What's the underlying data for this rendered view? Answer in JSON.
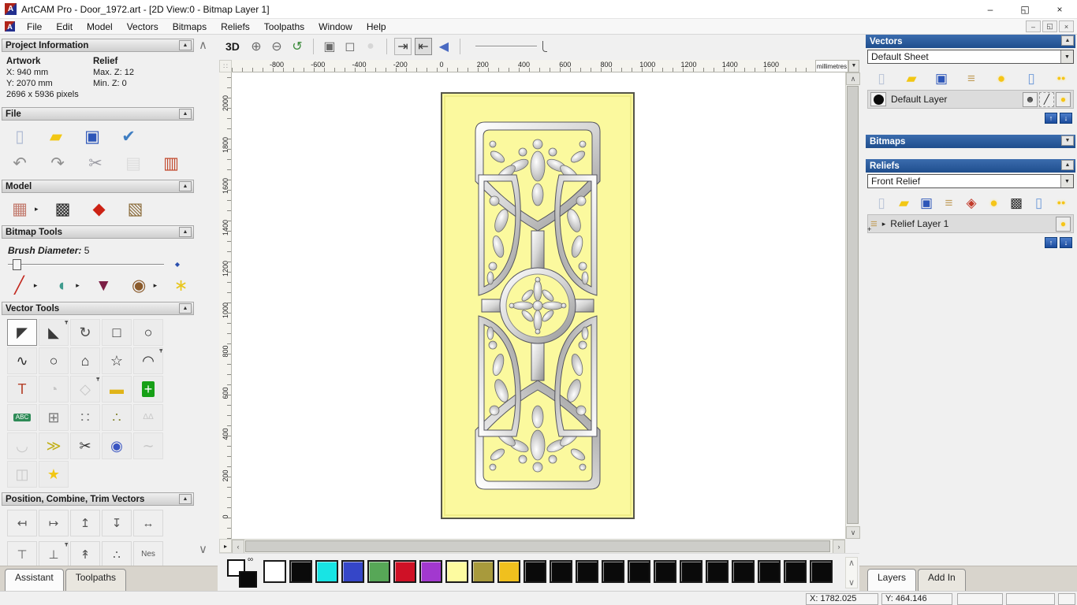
{
  "window": {
    "title": "ArtCAM Pro - Door_1972.art - [2D View:0 - Bitmap Layer 1]",
    "app_initial": "A",
    "minimize": "–",
    "restore": "◱",
    "close": "×"
  },
  "menu": {
    "items": [
      "File",
      "Edit",
      "Model",
      "Vectors",
      "Bitmaps",
      "Reliefs",
      "Toolpaths",
      "Window",
      "Help"
    ],
    "mdi_minimize": "–",
    "mdi_restore": "◱",
    "mdi_close": "×"
  },
  "ui": {
    "collapse_up": "▲",
    "collapse_down": "▼",
    "scroll_up": "∧",
    "scroll_down": "∨",
    "expander": "▸",
    "corner_grid": "∷",
    "pan_glyph": "▸"
  },
  "assistant": {
    "project": {
      "title": "Project Information",
      "artwork_label": "Artwork",
      "relief_label": "Relief",
      "artwork_x": "X: 940 mm",
      "artwork_y": "Y: 2070 mm",
      "relief_max": "Max. Z: 12",
      "relief_min": "Min. Z: 0",
      "pixels": "2696 x 5936 pixels"
    },
    "file": {
      "title": "File",
      "row1": [
        {
          "n": "new-model-icon",
          "g": "▯",
          "c": "#aebad2"
        },
        {
          "n": "open-model-icon",
          "g": "▰",
          "c": "#f2c714"
        },
        {
          "n": "save-model-icon",
          "g": "▣",
          "c": "#2d56b8"
        },
        {
          "n": "model-properties-icon",
          "g": "✔",
          "c": "#3f7ec2"
        }
      ],
      "row2": [
        {
          "n": "undo-icon",
          "g": "↶",
          "c": "#8f8f8f"
        },
        {
          "n": "redo-icon",
          "g": "↷",
          "c": "#8f8f8f"
        },
        {
          "n": "cut-icon",
          "g": "✂",
          "c": "#9a9aa2"
        },
        {
          "n": "copy-icon",
          "g": "▤",
          "c": "#c6c6c6",
          "gray": true
        },
        {
          "n": "paste-icon",
          "g": "▥",
          "c": "#c24a2e"
        }
      ]
    },
    "model": {
      "title": "Model",
      "row": [
        {
          "n": "greyscale-preview-icon",
          "g": "▦",
          "c": "#c27b6e",
          "sub": true
        },
        {
          "n": "view-greyscale-icon",
          "g": "▩",
          "c": "#2b2b2b"
        },
        {
          "n": "lighting-icon",
          "g": "◆",
          "c": "#cc2214"
        },
        {
          "n": "load-image-icon",
          "g": "▧",
          "c": "#8a6b3a"
        }
      ]
    },
    "bitmap_tools": {
      "title": "Bitmap Tools",
      "brush_label": "Brush Diameter:",
      "brush_value": "5",
      "row": [
        {
          "n": "paint-brush-icon",
          "g": "╱",
          "c": "#c2271d",
          "sub": true
        },
        {
          "n": "flood-fill-icon",
          "g": "◖",
          "c": "#3f9b8e",
          "sub": true
        },
        {
          "n": "colour-picker-icon",
          "g": "▼",
          "c": "#7c1f45"
        },
        {
          "n": "palette-icon",
          "g": "◉",
          "c": "#8a5a2b",
          "sub": true
        },
        {
          "n": "texture-flood-icon",
          "g": "∗",
          "c": "#e8c61c"
        }
      ]
    },
    "vector_tools": {
      "title": "Vector Tools",
      "rows": [
        {
          "n": "select-vectors-icon",
          "g": "◤",
          "c": "#3a3a3a",
          "act": true
        },
        {
          "n": "node-editing-icon",
          "g": "◣",
          "c": "#3a3a3a",
          "pin": true
        },
        {
          "n": "transform-vectors-icon",
          "g": "↻",
          "c": "#4a4a4a"
        },
        {
          "n": "create-rectangle-icon",
          "g": "□",
          "c": "#2f2f2f"
        },
        {
          "n": "create-circle-icon",
          "g": "○",
          "c": "#2f2f2f"
        },
        {
          "n": "create-polyline-icon",
          "g": "∿",
          "c": "#2f2f2f"
        },
        {
          "n": "create-ellipse-icon",
          "g": "○",
          "c": "#2f2f2f"
        },
        {
          "n": "create-polygon-icon",
          "g": "⌂",
          "c": "#2f2f2f"
        },
        {
          "n": "create-star-icon",
          "g": "☆",
          "c": "#2f2f2f"
        },
        {
          "n": "create-arc-icon",
          "g": "◠",
          "c": "#2f2f2f",
          "pin": true
        },
        {
          "n": "create-text-icon",
          "g": "T",
          "c": "#b5412a"
        },
        {
          "n": "wrap-text-icon",
          "g": "◔",
          "c": "#9a9a9a",
          "gray": true
        },
        {
          "n": "offset-vector-icon",
          "g": "◇",
          "c": "#9a9a9a",
          "gray": true,
          "pin": true
        },
        {
          "n": "measure-icon",
          "g": "▬",
          "c": "#e0b418"
        },
        {
          "n": "create-boundary-icon",
          "g": "+",
          "c": "#ffffff",
          "bg": "#17a017"
        },
        {
          "n": "text-block-icon",
          "g": "ABC",
          "c": "#ffffff",
          "bg": "#2e8b57",
          "fs": 8
        },
        {
          "n": "distort-vectors-icon",
          "g": "⊞",
          "c": "#7a7a7a"
        },
        {
          "n": "block-copy-icon",
          "g": "∷",
          "c": "#7a7a7a"
        },
        {
          "n": "paste-along-curve-icon",
          "g": "∴",
          "c": "#8a8a3a"
        },
        {
          "n": "vector-texture-icon",
          "g": "ΔΔ",
          "c": "#9a9a9a",
          "gray": true,
          "fs": 10
        },
        {
          "n": "fillet-icon",
          "g": "◡",
          "c": "#9a9a9a",
          "gray": true
        },
        {
          "n": "join-vectors-icon",
          "g": "≫",
          "c": "#c2b018"
        },
        {
          "n": "trim-vectors-icon",
          "g": "✂",
          "c": "#2f2f2f"
        },
        {
          "n": "spin-profile-icon",
          "g": "◉",
          "c": "#3a55c2"
        },
        {
          "n": "fit-curve-icon",
          "g": "∼",
          "c": "#9a9a9a",
          "gray": true
        },
        {
          "n": "mirror-vectors-icon",
          "g": "◫",
          "c": "#9a9a9a",
          "gray": true
        },
        {
          "n": "wrap-copy-icon",
          "g": "★",
          "c": "#f2c714"
        }
      ]
    },
    "position": {
      "title": "Position, Combine, Trim Vectors",
      "row1": [
        {
          "n": "align-left-icon",
          "g": "↤"
        },
        {
          "n": "align-right-icon",
          "g": "↦"
        },
        {
          "n": "align-top-icon",
          "g": "↥"
        },
        {
          "n": "align-bottom-icon",
          "g": "↧"
        },
        {
          "n": "align-centre-icon",
          "g": "↔"
        }
      ],
      "row2": [
        {
          "n": "align-top-edge-icon",
          "g": "⊤"
        },
        {
          "n": "align-bottom-edge-icon",
          "g": "⊥",
          "pin": true
        },
        {
          "n": "align-vertical-icon",
          "g": "↟"
        },
        {
          "n": "paste-array-icon",
          "g": "∴"
        },
        {
          "n": "nesting-icon",
          "g": "Nes",
          "fs": 10
        }
      ]
    },
    "tabs": [
      {
        "label": "Assistant",
        "active": true
      },
      {
        "label": "Toolpaths",
        "active": false
      }
    ]
  },
  "canvas_toolbar": {
    "view3d": "3D",
    "items": [
      {
        "n": "zoom-in-icon",
        "g": "⊕",
        "c": "#6a6a6a"
      },
      {
        "n": "zoom-out-icon",
        "g": "⊖",
        "c": "#6a6a6a"
      },
      {
        "n": "zoom-previous-icon",
        "g": "↺",
        "c": "#3a8a3a"
      },
      {
        "sep": true
      },
      {
        "n": "zoom-1to1-icon",
        "g": "▣",
        "c": "#6a6a6a"
      },
      {
        "n": "zoom-fit-icon",
        "g": "◻",
        "c": "#6a6a6a"
      },
      {
        "n": "zoom-object-icon",
        "g": "●",
        "c": "#b8b8b8",
        "gray": true
      },
      {
        "sep": true
      },
      {
        "n": "copy-bitmap-to-relief-icon",
        "g": "⇥",
        "c": "#3a3a3a",
        "box": true
      },
      {
        "n": "copy-relief-to-bitmap-icon",
        "g": "⇤",
        "c": "#3a3a3a",
        "box": true,
        "act": true
      },
      {
        "n": "relief-preview-icon",
        "g": "◀",
        "c": "#4a6ac2"
      },
      {
        "sep": true
      },
      {
        "slider": true
      }
    ]
  },
  "rulers": {
    "units": "millimetres",
    "top": [
      -800,
      -600,
      -400,
      -200,
      0,
      200,
      400,
      600,
      800,
      1000,
      1200,
      1400,
      1600
    ],
    "left": [
      0,
      200,
      400,
      600,
      800,
      1000,
      1200,
      1400,
      1600,
      1800,
      2000
    ]
  },
  "right_panel": {
    "vectors": {
      "title": "Vectors",
      "sheet_value": "Default Sheet",
      "layer_name": "Default Layer",
      "toolbar": [
        {
          "n": "new-vector-layer-icon",
          "g": "▯",
          "c": "#b8c2d6"
        },
        {
          "n": "open-vector-layer-icon",
          "g": "▰",
          "c": "#f2c714"
        },
        {
          "n": "save-vector-layer-icon",
          "g": "▣",
          "c": "#2d56b8"
        },
        {
          "n": "merge-layers-icon",
          "g": "≡",
          "c": "#c2a060"
        },
        {
          "n": "toggle-visibility-icon",
          "g": "●",
          "c": "#f5c518",
          "cls": "bulbglow"
        },
        {
          "n": "delete-layer-icon",
          "g": "▯",
          "c": "#6e9ad8"
        },
        {
          "n": "all-layers-visible-icon",
          "g": "●●",
          "c": "#f5c518",
          "cls": "bulbglow",
          "fs": 9
        }
      ],
      "layer_buttons": [
        {
          "n": "layer-lock-icon",
          "g": "☻",
          "c": "#4a4a4a"
        },
        {
          "n": "layer-snap-icon",
          "g": "╱",
          "c": "#2a2a2a",
          "cls2": "dash"
        },
        {
          "n": "layer-visibility-icon",
          "g": "●",
          "c": "#f5c518",
          "cls2": "bulb"
        }
      ]
    },
    "bitmaps": {
      "title": "Bitmaps"
    },
    "reliefs": {
      "title": "Reliefs",
      "relief_value": "Front Relief",
      "layer_name": "Relief Layer 1",
      "toolbar": [
        {
          "n": "new-relief-layer-icon",
          "g": "▯",
          "c": "#b8c2d6"
        },
        {
          "n": "open-relief-layer-icon",
          "g": "▰",
          "c": "#f2c714"
        },
        {
          "n": "save-relief-layer-icon",
          "g": "▣",
          "c": "#2d56b8"
        },
        {
          "n": "merge-relief-layers-icon",
          "g": "≡",
          "c": "#c2a060"
        },
        {
          "n": "combine-relief-icon",
          "g": "◈",
          "c": "#c23a2a"
        },
        {
          "n": "relief-visibility-icon",
          "g": "●",
          "c": "#f5c518",
          "cls": "bulbglow"
        },
        {
          "n": "relief-greyscale-icon",
          "g": "▩",
          "c": "#2b2b2b"
        },
        {
          "n": "delete-relief-layer-icon",
          "g": "▯",
          "c": "#6e9ad8"
        },
        {
          "n": "all-reliefs-visible-icon",
          "g": "●●",
          "c": "#f5c518",
          "cls": "bulbglow",
          "fs": 9
        }
      ]
    },
    "tabs": [
      {
        "label": "Layers",
        "active": true
      },
      {
        "label": "Add In",
        "active": false
      }
    ]
  },
  "palette": {
    "swatches": [
      "#ffffff",
      "#0a0a0a",
      "#18e4e4",
      "#3546c8",
      "#57a757",
      "#cf1126",
      "#a238cf",
      "#fdfba0",
      "#a89a3c",
      "#f0c01e",
      "#0a0a0a",
      "#0a0a0a",
      "#0a0a0a",
      "#0a0a0a",
      "#0a0a0a",
      "#0a0a0a",
      "#0a0a0a",
      "#0a0a0a",
      "#0a0a0a",
      "#0a0a0a",
      "#0a0a0a",
      "#0a0a0a"
    ]
  },
  "status": {
    "cells": [
      "X: 1782.025",
      "Y: 464.146",
      "",
      "",
      ""
    ]
  }
}
